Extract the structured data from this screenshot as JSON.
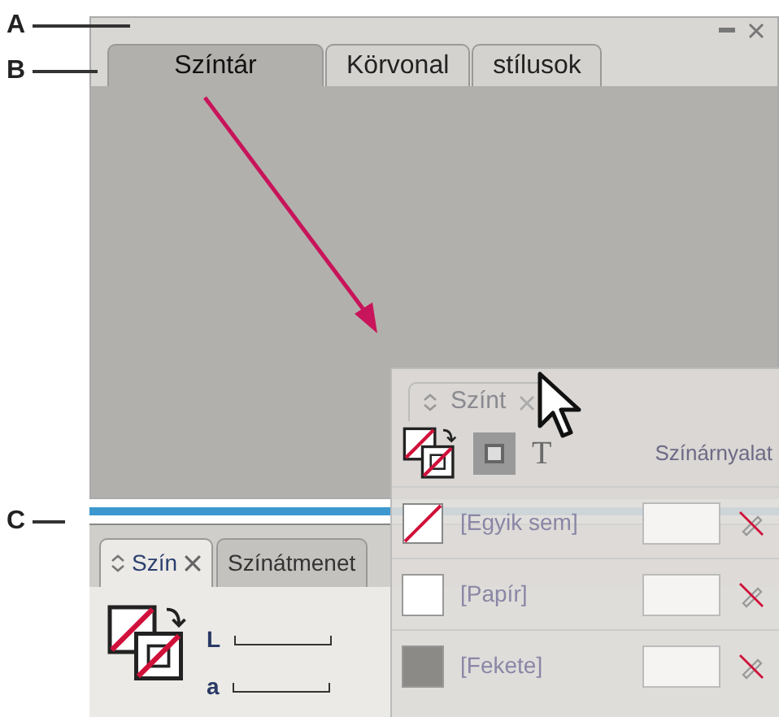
{
  "callouts": [
    {
      "label": "A"
    },
    {
      "label": "B"
    },
    {
      "label": "C"
    }
  ],
  "swatches_panel": {
    "tabs": [
      {
        "label": "Színtár",
        "selected": true
      },
      {
        "label": "Körvonal",
        "selected": false
      },
      {
        "label": "stílusok",
        "selected": false
      }
    ]
  },
  "dragged_panel": {
    "tab_label": "Színt",
    "format_icon": "T",
    "tint_label": "Színárnyalat",
    "rows": [
      {
        "name": "[Egyik sem]",
        "kind": "none"
      },
      {
        "name": "[Papír]",
        "kind": "paper"
      },
      {
        "name": "[Fekete]",
        "kind": "black"
      }
    ]
  },
  "color_panel": {
    "tabs": [
      {
        "label": "Szín",
        "selected": true
      },
      {
        "label": "Színátmenet",
        "selected": false
      }
    ],
    "channels": [
      {
        "label": "L"
      },
      {
        "label": "a"
      }
    ]
  }
}
